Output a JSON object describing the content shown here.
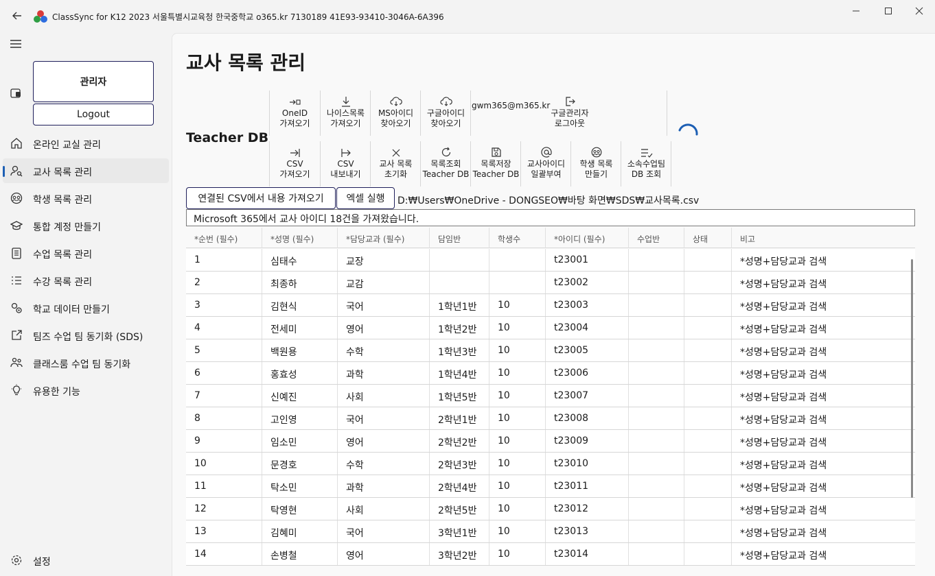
{
  "window": {
    "title": "ClassSync for K12 2023 서울특별시교육청 한국중학교 o365.kr 7130189 41E93-93410-3046A-6A396"
  },
  "sidebar": {
    "admin_label": "관리자",
    "logout_label": "Logout",
    "items": [
      {
        "label": "온라인 교실 관리",
        "icon": "home-icon"
      },
      {
        "label": "교사 목록 관리",
        "icon": "person-search-icon"
      },
      {
        "label": "학생 목록 관리",
        "icon": "group-icon"
      },
      {
        "label": "통합 계정 만들기",
        "icon": "graduation-cap-icon"
      },
      {
        "label": "수업 목록 관리",
        "icon": "clipboard-list-icon"
      },
      {
        "label": "수강 목록 관리",
        "icon": "checklist-icon"
      },
      {
        "label": "학교 데이터 만들기",
        "icon": "data-gear-icon"
      },
      {
        "label": "팀즈 수업 팀 동기화 (SDS)",
        "icon": "share-icon"
      },
      {
        "label": "클래스룸 수업 팀 동기화",
        "icon": "people-icon"
      },
      {
        "label": "유용한 기능",
        "icon": "lightbulb-icon"
      }
    ],
    "settings_label": "설정"
  },
  "main": {
    "page_title": "교사 목록 관리",
    "section_title": "Teacher DB",
    "toolbar_row1": [
      {
        "line1": "OneID",
        "line2": "가져오기",
        "icon": "import-arrow-icon"
      },
      {
        "line1": "나이스목록",
        "line2": "가져오기",
        "icon": "download-icon"
      },
      {
        "line1": "MS아이디",
        "line2": "찾아오기",
        "icon": "cloud-download-icon"
      },
      {
        "line1": "구글아이디",
        "line2": "찾아오기",
        "icon": "cloud-download-icon"
      }
    ],
    "google_account": "gwm365@m365.kr",
    "google_logout": {
      "line1": "구글관리자",
      "line2": "로그아웃",
      "icon": "sign-out-icon"
    },
    "toolbar_row2": [
      {
        "line1": "CSV",
        "line2": "가져오기",
        "icon": "arrow-to-line-icon"
      },
      {
        "line1": "CSV",
        "line2": "내보내기",
        "icon": "arrow-from-line-icon"
      },
      {
        "line1": "교사 목록",
        "line2": "초기화",
        "icon": "x-icon"
      },
      {
        "line1": "목록조회",
        "line2": "Teacher DB",
        "icon": "refresh-icon"
      },
      {
        "line1": "목록저장",
        "line2": "Teacher DB",
        "icon": "save-icon"
      },
      {
        "line1": "교사아이디",
        "line2": "일괄부여",
        "icon": "at-icon"
      },
      {
        "line1": "학생 목록",
        "line2": "만들기",
        "icon": "group-icon"
      },
      {
        "line1": "소속수업팀",
        "line2": "DB 조회",
        "icon": "list-check-icon"
      }
    ],
    "import_csv_button": "연결된 CSV에서 내용 가져오기",
    "excel_button": "엑셀 실행",
    "csv_path": "D:₩Users₩OneDrive - DONGSEO₩바탕 화면₩SDS₩교사목록.csv",
    "status_message": "Microsoft 365에서 교사 아이디 18건을 가져왔습니다."
  },
  "grid": {
    "headers": [
      "*순번 (필수)",
      "*성명 (필수)",
      "*담당교과 (필수)",
      "담임반",
      "학생수",
      "*아이디 (필수)",
      "수업반",
      "상태",
      "비고"
    ],
    "rows": [
      [
        "1",
        "심태수",
        "교장",
        "",
        "",
        "t23001",
        "",
        "",
        "*성명+담당교과 검색"
      ],
      [
        "2",
        "최종하",
        "교감",
        "",
        "",
        "t23002",
        "",
        "",
        "*성명+담당교과 검색"
      ],
      [
        "3",
        "김현식",
        "국어",
        "1학년1반",
        "10",
        "t23003",
        "",
        "",
        "*성명+담당교과 검색"
      ],
      [
        "4",
        "전세미",
        "영어",
        "1학년2반",
        "10",
        "t23004",
        "",
        "",
        "*성명+담당교과 검색"
      ],
      [
        "5",
        "백원용",
        "수학",
        "1학년3반",
        "10",
        "t23005",
        "",
        "",
        "*성명+담당교과 검색"
      ],
      [
        "6",
        "홍효성",
        "과학",
        "1학년4반",
        "10",
        "t23006",
        "",
        "",
        "*성명+담당교과 검색"
      ],
      [
        "7",
        "신예진",
        "사회",
        "1학년5반",
        "10",
        "t23007",
        "",
        "",
        "*성명+담당교과 검색"
      ],
      [
        "8",
        "고인영",
        "국어",
        "2학년1반",
        "10",
        "t23008",
        "",
        "",
        "*성명+담당교과 검색"
      ],
      [
        "9",
        "임소민",
        "영어",
        "2학년2반",
        "10",
        "t23009",
        "",
        "",
        "*성명+담당교과 검색"
      ],
      [
        "10",
        "문경호",
        "수학",
        "2학년3반",
        "10",
        "t23010",
        "",
        "",
        "*성명+담당교과 검색"
      ],
      [
        "11",
        "탁소민",
        "과학",
        "2학년4반",
        "10",
        "t23011",
        "",
        "",
        "*성명+담당교과 검색"
      ],
      [
        "12",
        "탁영현",
        "사회",
        "2학년5반",
        "10",
        "t23012",
        "",
        "",
        "*성명+담당교과 검색"
      ],
      [
        "13",
        "김혜미",
        "국어",
        "3학년1반",
        "10",
        "t23013",
        "",
        "",
        "*성명+담당교과 검색"
      ],
      [
        "14",
        "손병철",
        "영어",
        "3학년2반",
        "10",
        "t23014",
        "",
        "",
        "*성명+담당교과 검색"
      ]
    ]
  },
  "colors": {
    "accent": "#1d5fb4",
    "button_border": "#1e1e5a",
    "app_logo_red": "#d83b3b",
    "app_logo_green": "#2f9e44",
    "app_logo_blue": "#2d6cdf"
  }
}
